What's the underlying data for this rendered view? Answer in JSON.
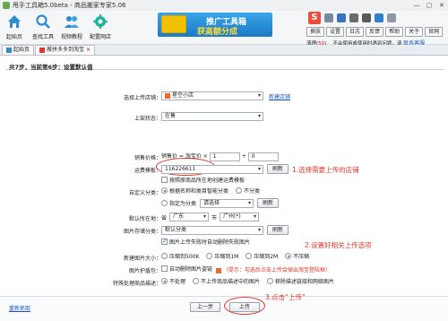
{
  "window": {
    "title": "甩手工具箱5.0beta - 商品搬家专家5.06",
    "min": "—",
    "max": "▢",
    "close": "✕"
  },
  "toolbar": {
    "items": [
      {
        "label": "起始页"
      },
      {
        "label": "查找工具"
      },
      {
        "label": "视频教程"
      },
      {
        "label": "配置网店"
      }
    ],
    "banner": {
      "line1": "推广工具箱",
      "line2": "获高额分成"
    },
    "s_icon": "S",
    "buttons": [
      "换肤",
      "设置",
      "日志",
      "反馈",
      "帮助",
      "关于",
      "官网"
    ],
    "user_prefix": "清理(",
    "user_count": "50",
    "user_suffix": ")",
    "notice": "不会使用或使用时遇到问题，请",
    "notice_link": "联系客服"
  },
  "tabs": [
    {
      "label": "起始页"
    },
    {
      "label": "搬拼多多到淘宝"
    }
  ],
  "step_header": "共7步，当前第6步：设置默认值",
  "form": {
    "store": {
      "label": "选择上传店铺：",
      "value": "星空小店",
      "link": "新建店铺"
    },
    "shelf": {
      "label": "上架状态：",
      "value": "在售"
    },
    "price": {
      "label": "销售价格：",
      "prefix": "销售价 = 淘宝价 ×",
      "mult": "1",
      "plus": "+",
      "add": "0"
    },
    "shipping": {
      "label": "运费模板：",
      "value": "116226611",
      "btn": "刷新",
      "chk": "按照原商品所在地创建运费模板"
    },
    "category": {
      "label": "自定义分类：",
      "opt1": "根据名称和类目智能分类",
      "opt2": "不分类",
      "opt3": "指定为分类",
      "opt3_value": "请选择",
      "btn": "刷新"
    },
    "location": {
      "label": "默认所在地：",
      "prov_label": "省",
      "prov": "广东",
      "city_label": "市",
      "city": "广州(*)"
    },
    "imgcat": {
      "label": "图片存储分类：",
      "value": "默认分类",
      "btn": "刷新",
      "chk": "图片上传失败时自动删除失败图片"
    },
    "mainimg": {
      "label": "新建图片大小：",
      "opt1": "压缩到500K",
      "opt2": "压缩到1M",
      "opt3": "压缩到2M",
      "opt4": "不压缩"
    },
    "protect": {
      "label": "图片护盾包：",
      "chk": "自动删除图片盗链",
      "tip": "（提示：勾选后点击上传会弹出淘宝登陆框）"
    },
    "special": {
      "label": "特殊处理商品描述：",
      "opt1": "不处理",
      "opt2": "不上传商品描述中的图片",
      "opt3": "移除描述链接和网络图片"
    }
  },
  "annotations": {
    "a1": "1.选择需要上传的店铺",
    "a2": "2.设置好相关上传选项",
    "a3": "3.点击“上传”"
  },
  "bottom": {
    "reset": "重新抓取",
    "prev": "上一步",
    "upload": "上传"
  }
}
